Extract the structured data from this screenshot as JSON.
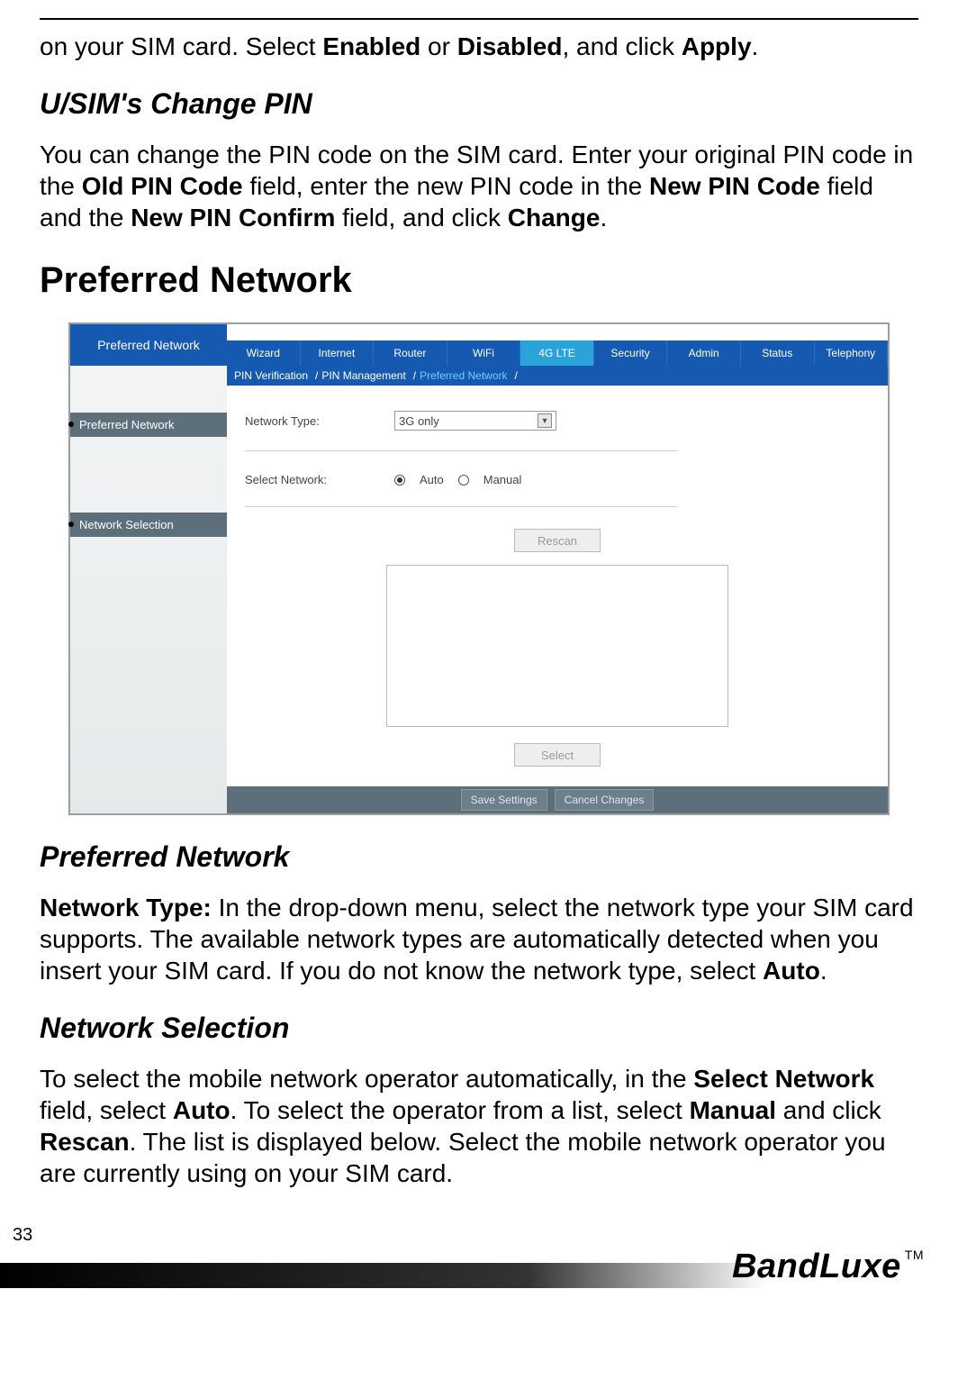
{
  "intro": {
    "line1_a": "on your SIM card. Select ",
    "enabled": "Enabled",
    "line1_b": " or ",
    "disabled": "Disabled",
    "line1_c": ", and click ",
    "apply": "Apply",
    "line1_d": "."
  },
  "usim": {
    "heading": "U/SIM's Change PIN",
    "p_a": "You can change the PIN code on the SIM card. Enter your original PIN code in the ",
    "old_pin": "Old PIN Code",
    "p_b": " field, enter the new PIN code in the ",
    "new_pin": "New PIN Code",
    "p_c": " field and the ",
    "new_pin_confirm": "New PIN Confirm",
    "p_d": " field, and click ",
    "change": "Change",
    "p_e": "."
  },
  "section_title": "Preferred Network",
  "ui": {
    "sidebar_title": "Preferred Network",
    "side_items": [
      "Preferred Network",
      "Network Selection"
    ],
    "tabs": [
      "Wizard",
      "Internet",
      "Router",
      "WiFi",
      "4G LTE",
      "Security",
      "Admin",
      "Status",
      "Telephony"
    ],
    "active_tab_index": 4,
    "breadcrumb": [
      "PIN Verification",
      "PIN Management",
      "Preferred Network"
    ],
    "breadcrumb_sep": "/",
    "form": {
      "network_type_label": "Network Type:",
      "network_type_value": "3G only",
      "select_network_label": "Select Network:",
      "radio_auto": "Auto",
      "radio_manual": "Manual",
      "rescan_btn": "Rescan",
      "select_btn": "Select"
    },
    "bottom": {
      "save": "Save Settings",
      "cancel": "Cancel Changes"
    }
  },
  "preferred_network": {
    "heading": "Preferred Network",
    "label": "Network Type:",
    "p_a": " In the drop-down menu, select the network type your SIM card supports. The available network types are automatically detected when you insert your SIM card. If you do not know the network type, select ",
    "auto": "Auto",
    "p_b": "."
  },
  "network_selection": {
    "heading": "Network Selection",
    "p_a": "To select the mobile network operator automatically, in the ",
    "select_network": "Select Network",
    "p_b": " field, select ",
    "auto": "Auto",
    "p_c": ". To select the operator from a list, select ",
    "manual": "Manual",
    "p_d": " and click ",
    "rescan": "Rescan",
    "p_e": ". The list is displayed below. Select the mobile network operator you are currently using on your SIM card."
  },
  "page_number": "33",
  "brand": "BandLuxe",
  "tm": "TM"
}
